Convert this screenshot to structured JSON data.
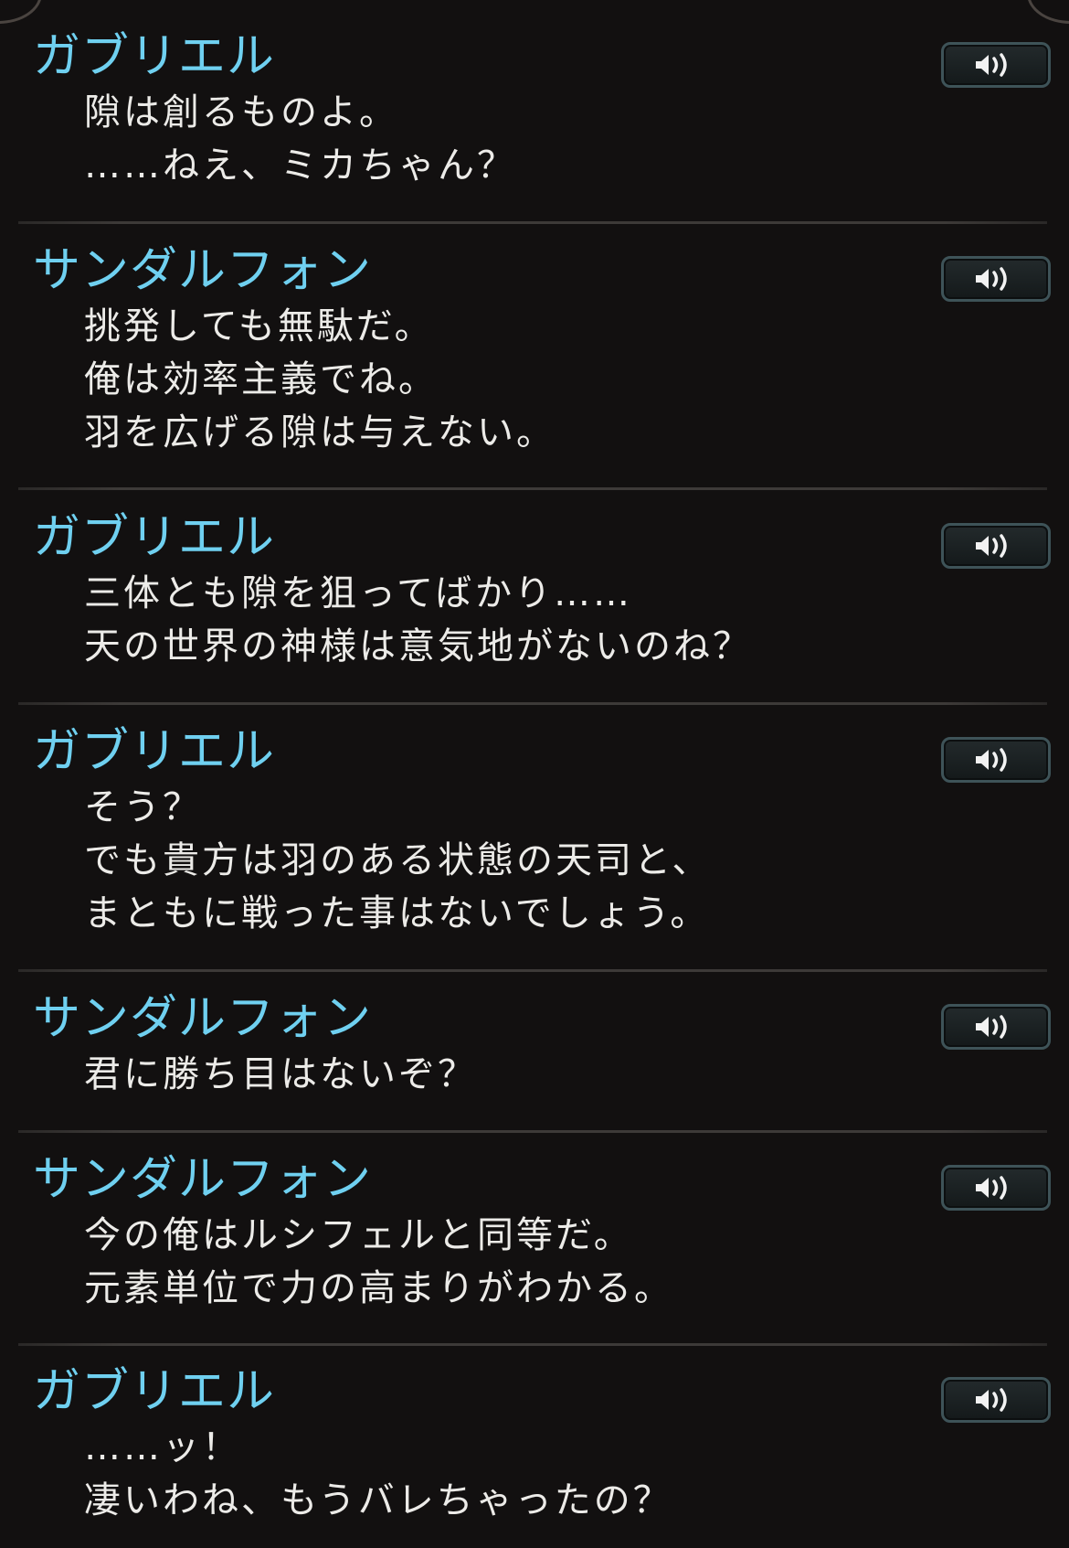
{
  "log": {
    "entries": [
      {
        "speaker": "ガブリエル",
        "lines": [
          "隙は創るものよ。",
          "……ねえ、ミカちゃん？"
        ],
        "voice_icon": "speaker-icon"
      },
      {
        "speaker": "サンダルフォン",
        "lines": [
          "挑発しても無駄だ。",
          "俺は効率主義でね。",
          "羽を広げる隙は与えない。"
        ],
        "voice_icon": "speaker-icon"
      },
      {
        "speaker": "ガブリエル",
        "lines": [
          "三体とも隙を狙ってばかり……",
          "天の世界の神様は意気地がないのね？"
        ],
        "voice_icon": "speaker-icon"
      },
      {
        "speaker": "ガブリエル",
        "lines": [
          "そう？",
          "でも貴方は羽のある状態の天司と、",
          "まともに戦った事はないでしょう。"
        ],
        "voice_icon": "speaker-icon"
      },
      {
        "speaker": "サンダルフォン",
        "lines": [
          "君に勝ち目はないぞ？"
        ],
        "voice_icon": "speaker-icon"
      },
      {
        "speaker": "サンダルフォン",
        "lines": [
          "今の俺はルシフェルと同等だ。",
          "元素単位で力の高まりがわかる。"
        ],
        "voice_icon": "speaker-icon"
      },
      {
        "speaker": "ガブリエル",
        "lines": [
          "……ッ！",
          "凄いわね、もうバレちゃったの？"
        ],
        "voice_icon": "speaker-icon"
      }
    ]
  },
  "colors": {
    "background": "#121010",
    "speaker_name": "#6fd0f0",
    "dialogue_text": "#ecebe8",
    "button_border": "#3e5358"
  }
}
